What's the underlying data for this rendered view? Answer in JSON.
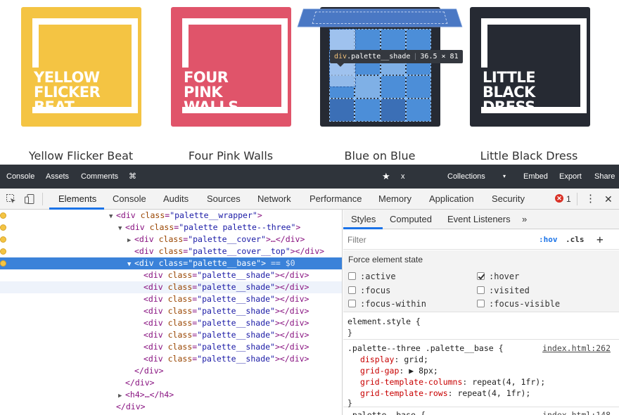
{
  "gallery": {
    "cards": [
      {
        "title": "YELLOW\nFLICKER\nBEAT.",
        "caption": "Yellow Flicker Beat",
        "color": "#f4c443"
      },
      {
        "title": "FOUR\nPINK\nWALLS.",
        "caption": "Four Pink Walls",
        "color": "#e0546a"
      },
      {
        "title": "",
        "caption": "Blue on Blue",
        "color": "#262a33"
      },
      {
        "title": "LITTLE\nBLACK\nDRESS.",
        "caption": "Little Black Dress",
        "color": "#262a33"
      }
    ],
    "tooltip": {
      "tag": "div",
      "cls": ".palette__shade",
      "size": "36.5 × 81"
    }
  },
  "sitebar": {
    "console": "Console",
    "assets": "Assets",
    "comments": "Comments",
    "cmd": "⌘",
    "star": "★",
    "close": "x",
    "collections": "Collections",
    "caret": "▾",
    "embed": "Embed",
    "export": "Export",
    "share": "Share"
  },
  "devtools": {
    "tabs": [
      "Elements",
      "Console",
      "Audits",
      "Sources",
      "Network",
      "Performance",
      "Memory",
      "Application",
      "Security"
    ],
    "error_count": "1",
    "more": "⋮",
    "close": "✕"
  },
  "elements": {
    "rows": [
      {
        "indent": 0,
        "tri": "▼",
        "open": "<div ",
        "attr": "class",
        "val": "palette__wrapper",
        "close": ">"
      },
      {
        "indent": 1,
        "tri": "▼",
        "open": "<div ",
        "attr": "class",
        "val": "palette palette--three",
        "close": ">"
      },
      {
        "indent": 2,
        "tri": "▶",
        "open": "<div ",
        "attr": "class",
        "val": "palette__cover",
        "close": ">…</div>"
      },
      {
        "indent": 2,
        "tri": "",
        "open": "<div ",
        "attr": "class",
        "val": "palette__cover__top",
        "close": "></div>"
      },
      {
        "indent": 1,
        "tri": "▼",
        "open": "<div ",
        "attr": "class",
        "val": "palette__base",
        "close": ">",
        "extra": " == $0"
      },
      {
        "indent": 2,
        "tri": "",
        "open": "<div ",
        "attr": "class",
        "val": "palette__shade",
        "close": "></div>"
      },
      {
        "indent": 2,
        "tri": "",
        "open": "<div ",
        "attr": "class",
        "val": "palette__shade",
        "close": "></div>"
      },
      {
        "indent": 2,
        "tri": "",
        "open": "<div ",
        "attr": "class",
        "val": "palette__shade",
        "close": "></div>"
      },
      {
        "indent": 2,
        "tri": "",
        "open": "<div ",
        "attr": "class",
        "val": "palette__shade",
        "close": "></div>"
      },
      {
        "indent": 2,
        "tri": "",
        "open": "<div ",
        "attr": "class",
        "val": "palette__shade",
        "close": "></div>"
      },
      {
        "indent": 2,
        "tri": "",
        "open": "<div ",
        "attr": "class",
        "val": "palette__shade",
        "close": "></div>"
      },
      {
        "indent": 2,
        "tri": "",
        "open": "<div ",
        "attr": "class",
        "val": "palette__shade",
        "close": "></div>"
      },
      {
        "indent": 2,
        "tri": "",
        "open": "<div ",
        "attr": "class",
        "val": "palette__shade",
        "close": "></div>"
      },
      {
        "indent": 2,
        "tri": "",
        "open": "</div>",
        "attr": "",
        "val": "",
        "close": ""
      },
      {
        "indent": 1,
        "tri": "",
        "open": "</div>",
        "attr": "",
        "val": "",
        "close": ""
      },
      {
        "indent": 1,
        "tri": "▶",
        "open": "<h4>…</h4>",
        "attr": "",
        "val": "",
        "close": ""
      },
      {
        "indent": 0,
        "tri": "",
        "open": "</div>",
        "attr": "",
        "val": "",
        "close": ""
      }
    ]
  },
  "styles": {
    "tabs": [
      "Styles",
      "Computed",
      "Event Listeners",
      "»"
    ],
    "filter_placeholder": "Filter",
    "hov": ":hov",
    "cls": ".cls",
    "plus": "+",
    "force_title": "Force element state",
    "states": [
      {
        "label": ":active",
        "checked": false
      },
      {
        "label": ":hover",
        "checked": true
      },
      {
        "label": ":focus",
        "checked": false
      },
      {
        "label": ":visited",
        "checked": false
      },
      {
        "label": ":focus-within",
        "checked": false
      },
      {
        "label": ":focus-visible",
        "checked": false
      }
    ],
    "element_style": {
      "selector": "element.style {",
      "close": "}"
    },
    "rule1": {
      "selector": ".palette--three .palette__base {",
      "source": "index.html:262",
      "props": [
        {
          "name": "display",
          "value": "grid;"
        },
        {
          "name": "grid-gap",
          "value": "▶ 8px;"
        },
        {
          "name": "grid-template-columns",
          "value": "repeat(4, 1fr);"
        },
        {
          "name": "grid-template-rows",
          "value": "repeat(4, 1fr);"
        }
      ],
      "close": "}"
    },
    "rule2": {
      "selector": ".palette__base {",
      "source": "index.html:148"
    }
  }
}
